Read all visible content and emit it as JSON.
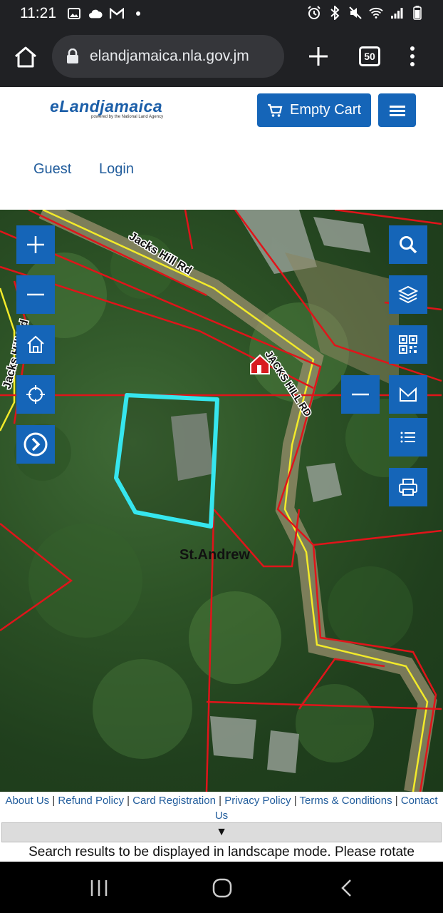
{
  "status_bar": {
    "time": "11:21",
    "left_icons": [
      "image-icon",
      "cloud-icon",
      "gmail-icon",
      "dot-icon"
    ],
    "right_icons": [
      "alarm-icon",
      "bluetooth-icon",
      "mute-icon",
      "wifi-icon",
      "signal-icon",
      "battery-icon"
    ]
  },
  "browser": {
    "url": "elandjamaica.nla.gov.jm",
    "tab_count": "50"
  },
  "header": {
    "logo_text": "eLandjamaica",
    "logo_tagline": "powered by the National Land Agency",
    "cart_label": "Empty Cart",
    "nav": {
      "guest": "Guest",
      "login": "Login"
    }
  },
  "map": {
    "road_labels": [
      "Jacks Hill Rd",
      "JACKS HILL RD",
      "Jacks Hill Rd"
    ],
    "place_label": "St.Andrew",
    "left_controls": [
      "zoom-in",
      "zoom-out",
      "home",
      "locate",
      "expand"
    ],
    "right_controls": [
      "search",
      "layers",
      "qr-code",
      "mail",
      "list",
      "print"
    ],
    "colors": {
      "parcel_highlight": "#36e6ee",
      "parcel_lines": "#e0141a",
      "road_line": "#f2ea2a",
      "control_blue": "#1565b8"
    }
  },
  "footer": {
    "links": [
      "About Us",
      "Refund Policy",
      "Card Registration",
      "Privacy Policy",
      "Terms & Conditions",
      "Contact Us"
    ],
    "collapse_glyph": "▼",
    "notice": "Search results to be displayed in landscape mode. Please rotate"
  }
}
